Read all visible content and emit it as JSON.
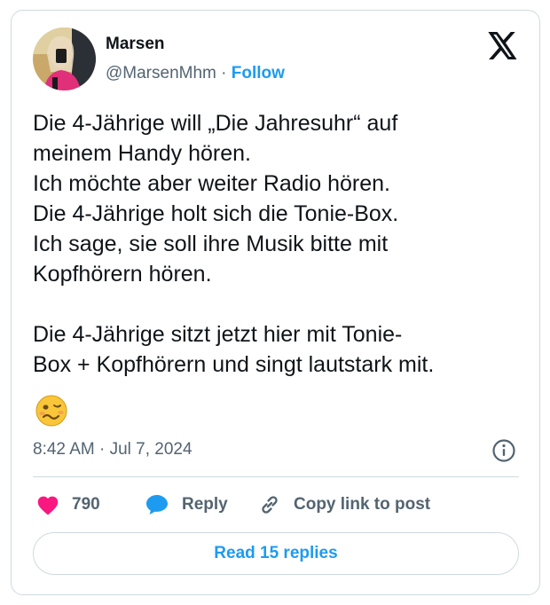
{
  "author": {
    "name": "Marsen",
    "handle": "@MarsenMhm",
    "separator": "·",
    "follow_label": "Follow"
  },
  "tweet": {
    "lines": [
      "Die 4-Jährige will „Die Jahresuhr“ auf",
      "meinem Handy hören.",
      "Ich möchte aber weiter Radio hören.",
      "Die 4-Jährige holt sich die Tonie-Box.",
      "Ich sage, sie soll ihre Musik bitte mit",
      "Kopfhörern hören.",
      "Die 4-Jährige sitzt jetzt hier mit Tonie-",
      "Box + Kopfhörern und singt lautstark mit."
    ],
    "emoji": "woozy-face",
    "timestamp": "8:42 AM · Jul 7, 2024"
  },
  "actions": {
    "like_count": "790",
    "reply_label": "Reply",
    "copy_label": "Copy link to post"
  },
  "read_replies_label": "Read 15 replies",
  "colors": {
    "accent": "#1d9bf0",
    "like": "#f91880",
    "text": "#0f1419",
    "secondary": "#536471",
    "border": "#cfd9de"
  },
  "icons": [
    "x-logo-icon",
    "info-icon",
    "heart-icon",
    "speech-bubble-icon",
    "link-icon",
    "woozy-face-emoji"
  ]
}
